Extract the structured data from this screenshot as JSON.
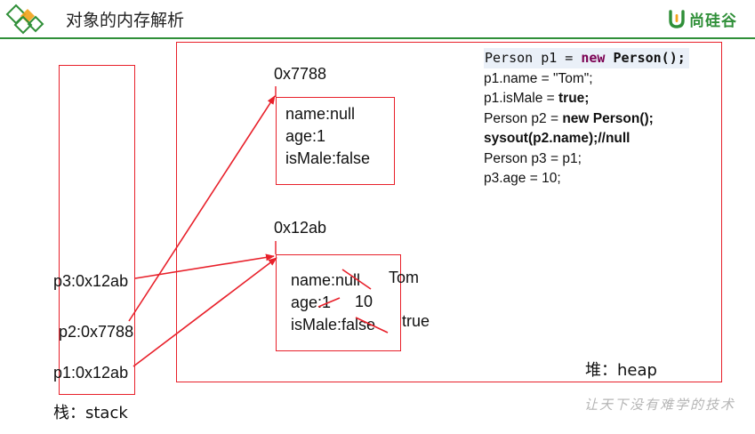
{
  "title": "对象的内存解析",
  "brand": {
    "name": "尚硅谷",
    "color": "#2f8f38"
  },
  "code_lines": [
    {
      "parts": [
        {
          "t": "Person p1 = ",
          "s": "mono"
        },
        {
          "t": "new",
          "s": "kw"
        },
        {
          "t": " Person();",
          "s": "mono-b"
        }
      ]
    },
    {
      "parts": [
        {
          "t": "p1.name = \"Tom\";",
          "s": ""
        }
      ]
    },
    {
      "parts": [
        {
          "t": "p1.isMale = ",
          "s": ""
        },
        {
          "t": "true;",
          "s": "b"
        }
      ]
    },
    {
      "parts": [
        {
          "t": "Person p2 = ",
          "s": ""
        },
        {
          "t": "new Person();",
          "s": "b"
        }
      ]
    },
    {
      "parts": [
        {
          "t": "sysout(p2.name);//null",
          "s": "b"
        }
      ]
    },
    {
      "parts": [
        {
          "t": "Person p3 = p1;",
          "s": ""
        }
      ]
    },
    {
      "parts": [
        {
          "t": "p3.age = 10;",
          "s": ""
        }
      ]
    }
  ],
  "heap": {
    "label": "堆：heap",
    "objects": [
      {
        "address": "0x7788",
        "fields": [
          "name:null",
          "age:1",
          "isMale:false"
        ]
      },
      {
        "address": "0x12ab",
        "fields": [
          "name:null",
          "age:1",
          "isMale:false"
        ],
        "updates": [
          "Tom",
          "10",
          "true"
        ]
      }
    ]
  },
  "stack": {
    "label": "栈：stack",
    "vars": [
      "p3:0x12ab",
      "p2:0x7788",
      "p1:0x12ab"
    ]
  },
  "watermark": "让天下没有难学的技术",
  "colors": {
    "accent": "#e8202a",
    "keyword": "#7b0052"
  }
}
